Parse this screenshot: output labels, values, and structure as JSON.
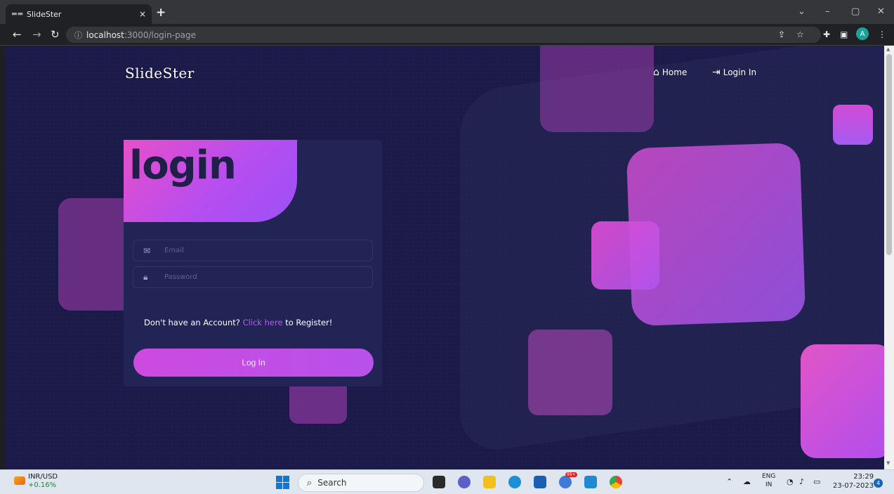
{
  "browser": {
    "tab_title": "SlideSter",
    "tab_close": "×",
    "new_tab": "+",
    "url_host": "localhost",
    "url_path": ":3000/login-page",
    "profile_initial": "A",
    "window_controls": {
      "menu": "⌄",
      "minimize": "–",
      "restore": "▢",
      "close": "✕"
    }
  },
  "nav": {
    "brand": "SlideSter",
    "links": [
      {
        "icon": "home-icon",
        "label": "Home"
      },
      {
        "icon": "login-arrow-icon",
        "label": "Login In"
      }
    ]
  },
  "login": {
    "heading": "login",
    "email_placeholder": "Email",
    "password_placeholder": "Password",
    "register_prefix": "Don't have an Account?",
    "register_link": "Click here",
    "register_suffix": "to Register!",
    "submit_label": "Log In"
  },
  "colors": {
    "page_bg": "#1b1a48",
    "card_bg": "#232456",
    "accent_pink": "#e84fc8",
    "accent_purple": "#9b50f7"
  },
  "taskbar": {
    "ticker_name": "INR/USD",
    "ticker_change": "+0.16%",
    "search_label": "Search",
    "lang_top": "ENG",
    "lang_bottom": "IN",
    "time": "23:29",
    "date": "23-07-2023",
    "notification_count": "4",
    "badge_count": "99+"
  }
}
